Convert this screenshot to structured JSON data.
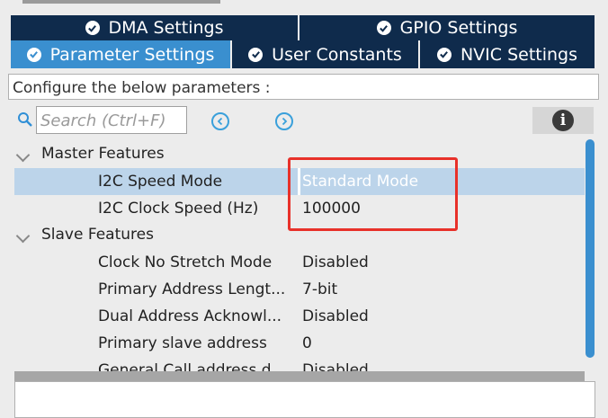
{
  "tabs_row1": [
    {
      "label": "DMA Settings",
      "icon": "check-circle-icon"
    },
    {
      "label": "GPIO Settings",
      "icon": "check-circle-icon"
    }
  ],
  "tabs_row2": [
    {
      "label": "Parameter Settings",
      "icon": "check-circle-icon",
      "active": true
    },
    {
      "label": "User Constants",
      "icon": "check-circle-icon"
    },
    {
      "label": "NVIC Settings",
      "icon": "check-circle-icon"
    }
  ],
  "description": "Configure the below parameters :",
  "search": {
    "placeholder": "Search (Ctrl+F)"
  },
  "groups": {
    "master": "Master Features",
    "slave": "Slave Features"
  },
  "master_params": [
    {
      "name": "I2C Speed Mode",
      "value": "Standard Mode"
    },
    {
      "name": "I2C Clock Speed (Hz)",
      "value": "100000"
    }
  ],
  "slave_params": [
    {
      "name": "Clock No Stretch Mode",
      "value": "Disabled"
    },
    {
      "name": "Primary Address Lengt...",
      "value": "7-bit"
    },
    {
      "name": "Dual Address Acknowl...",
      "value": "Disabled"
    },
    {
      "name": "Primary slave address",
      "value": "0"
    },
    {
      "name": "General Call address d...",
      "value": "Disabled"
    }
  ],
  "colors": {
    "tab_dark": "#0f2b4c",
    "tab_active": "#3a8fcf",
    "selection": "#bcd4ea",
    "highlight": "#e8312a"
  }
}
